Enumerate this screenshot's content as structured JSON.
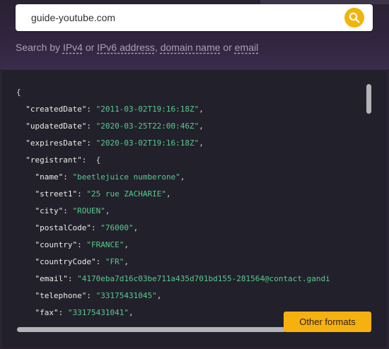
{
  "search": {
    "value": "guide-youtube.com",
    "button_icon": "search-icon",
    "button_color": "#f2b40a"
  },
  "hint": {
    "prefix": "Search by",
    "ipv4": "IPv4",
    "or1": "or",
    "ipv6": "IPv6 address",
    "comma": ",",
    "domain": "domain name",
    "or2": "or",
    "email": "email"
  },
  "code_lines": [
    {
      "indent": 0,
      "key": "",
      "value": "",
      "text": "{"
    },
    {
      "indent": 1,
      "key": "\"createdDate\"",
      "value": "\"2011-03-02T19:16:18Z\"",
      "tail": ","
    },
    {
      "indent": 1,
      "key": "\"updatedDate\"",
      "value": "\"2020-03-25T22:00:46Z\"",
      "tail": ","
    },
    {
      "indent": 1,
      "key": "\"expiresDate\"",
      "value": "\"2020-03-02T19:16:18Z\"",
      "tail": ","
    },
    {
      "indent": 1,
      "key": "\"registrant\"",
      "value": "",
      "tail": " {"
    },
    {
      "indent": 2,
      "key": "\"name\"",
      "value": "\"beetlejuice numberone\"",
      "tail": ","
    },
    {
      "indent": 2,
      "key": "\"street1\"",
      "value": "\"25 rue ZACHARIE\"",
      "tail": ","
    },
    {
      "indent": 2,
      "key": "\"city\"",
      "value": "\"ROUEN\"",
      "tail": ","
    },
    {
      "indent": 2,
      "key": "\"postalCode\"",
      "value": "\"76000\"",
      "tail": ","
    },
    {
      "indent": 2,
      "key": "\"country\"",
      "value": "\"FRANCE\"",
      "tail": ","
    },
    {
      "indent": 2,
      "key": "\"countryCode\"",
      "value": "\"FR\"",
      "tail": ","
    },
    {
      "indent": 2,
      "key": "\"email\"",
      "value": "\"4170eba7d16c03be711a435d701bd155-281564@contact.gandi",
      "tail": ""
    },
    {
      "indent": 2,
      "key": "\"telephone\"",
      "value": "\"33175431045\"",
      "tail": ","
    },
    {
      "indent": 2,
      "key": "\"fax\"",
      "value": "\"33175431041\"",
      "tail": ","
    }
  ],
  "other_formats_label": "Other formats",
  "colors": {
    "accent": "#f7b10f",
    "json_string": "#58c98f",
    "code_bg": "#22212b"
  }
}
